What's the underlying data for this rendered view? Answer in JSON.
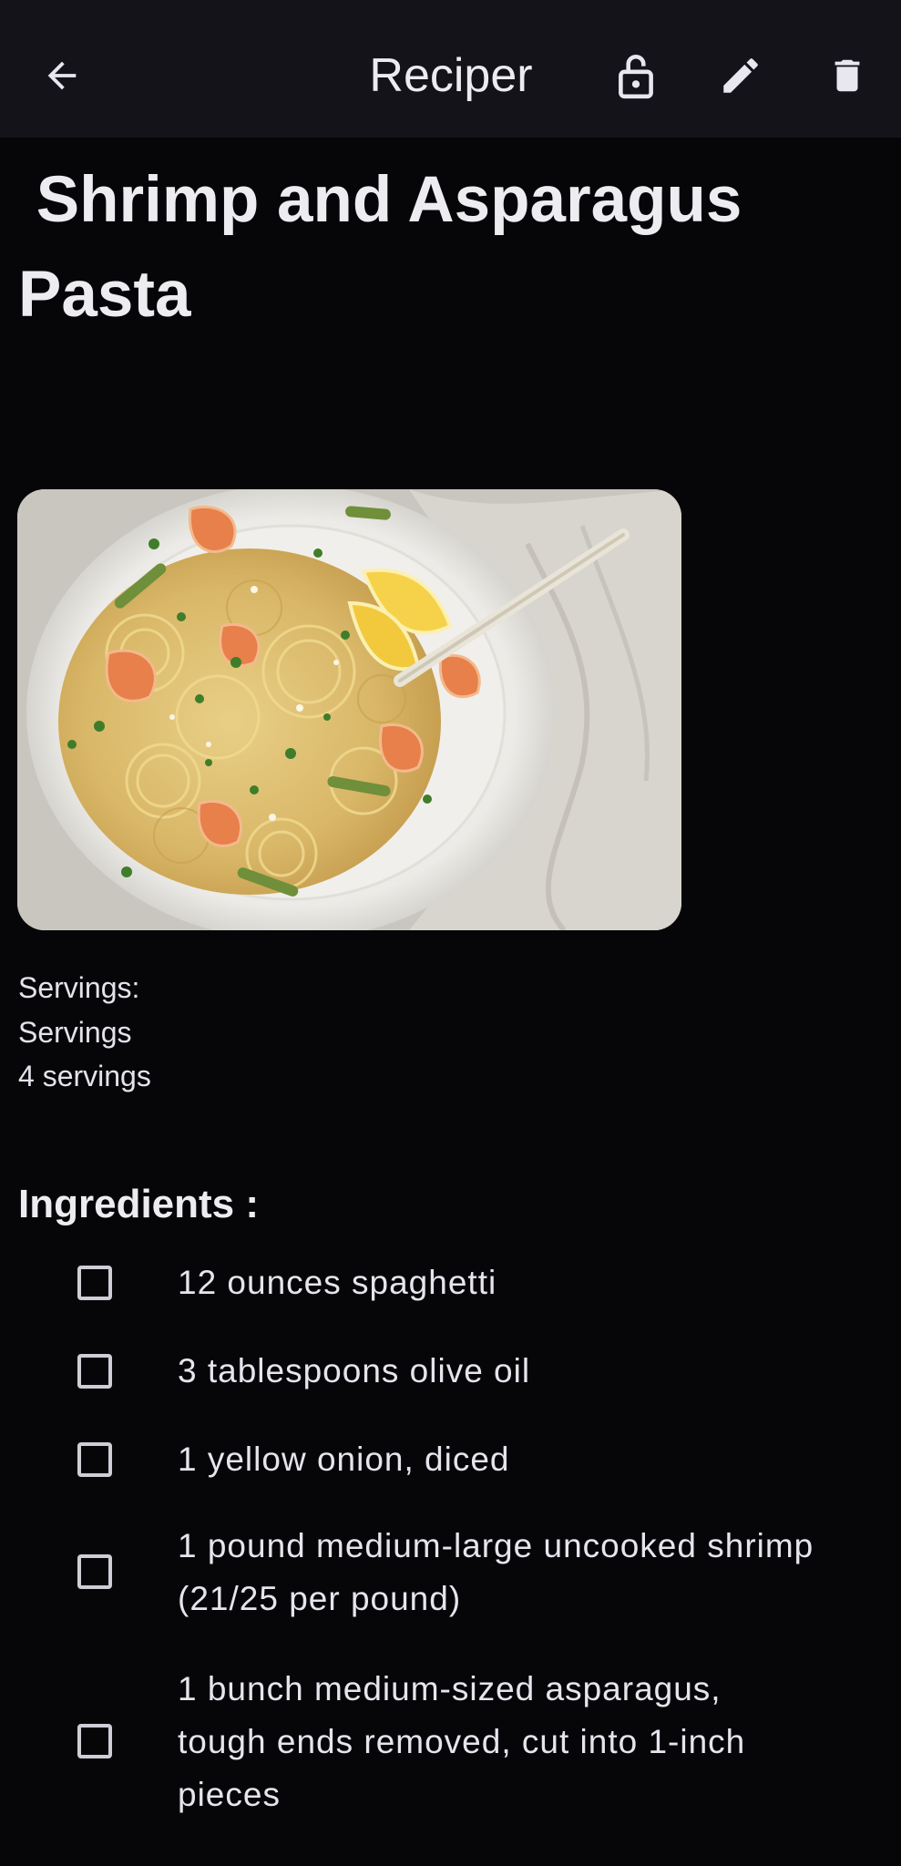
{
  "appbar": {
    "title": "Reciper",
    "back_icon": "arrow-left-icon",
    "lock_icon": "unlocked-padlock-icon",
    "edit_icon": "pencil-icon",
    "delete_icon": "trash-icon"
  },
  "recipe": {
    "title": " Shrimp and Asparagus\nPasta",
    "image_alt": "Shrimp and asparagus spaghetti on a white plate",
    "servings_label": "Servings:",
    "servings_name": "Servings",
    "servings_value": "4 servings"
  },
  "ingredients": {
    "heading": "Ingredients :",
    "items": [
      {
        "text": "12 ounces spaghetti",
        "checked": false
      },
      {
        "text": "3 tablespoons olive oil",
        "checked": false
      },
      {
        "text": "1 yellow onion, diced",
        "checked": false
      },
      {
        "text": "1 pound medium-large uncooked shrimp (21/25 per pound)",
        "checked": false
      },
      {
        "text": "1 bunch medium-sized asparagus, tough ends removed, cut into 1-inch pieces",
        "checked": false
      }
    ]
  },
  "colors": {
    "background": "#060609",
    "appbar": "#141319",
    "text": "#ecebf0"
  }
}
